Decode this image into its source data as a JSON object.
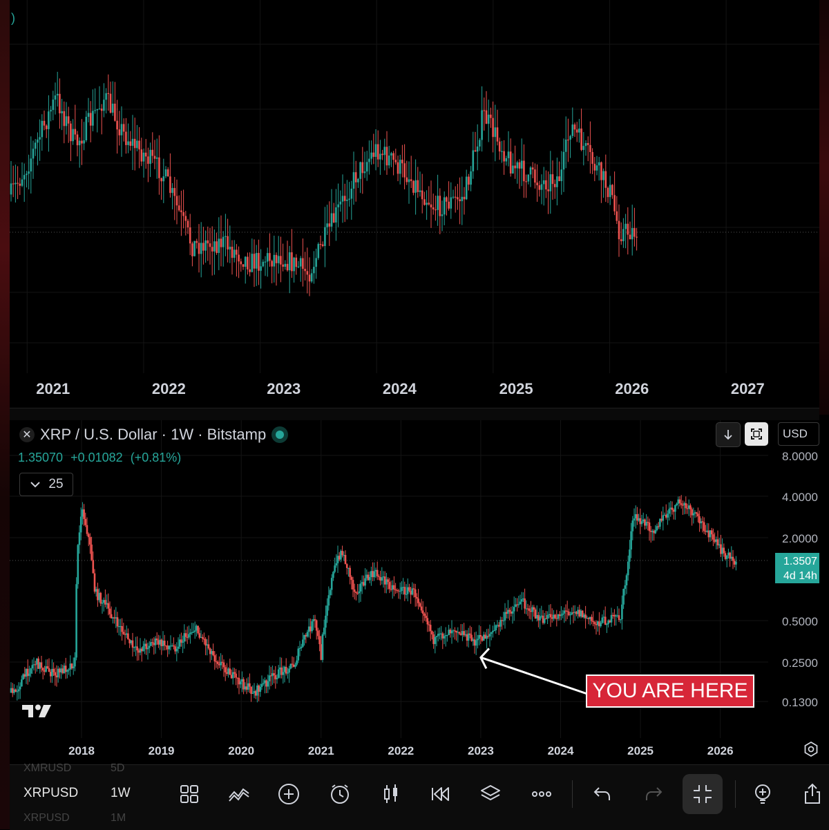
{
  "top_chart": {
    "corner_glyph": ")",
    "x_ticks": [
      "2021",
      "2022",
      "2023",
      "2024",
      "2025",
      "2026",
      "2027"
    ],
    "x_tick_pos": [
      0.045,
      0.188,
      0.33,
      0.473,
      0.617,
      0.76,
      0.903
    ]
  },
  "symbol_bar": {
    "icon": "xrp-icon",
    "title": "XRP / U.S. Dollar · 1W · Bitstamp",
    "status": "market-open-dot",
    "last_price": "1.35070",
    "change": "+0.01082",
    "change_pct": "(+0.81%)",
    "indicator_count": "25",
    "download_icon": "arrow-down-icon",
    "mode_icon": "scale-mode-icon",
    "currency": "USD"
  },
  "price_axis": {
    "labels": [
      "8.0000",
      "4.0000",
      "2.0000",
      "1.3507",
      "0.5000",
      "0.2500",
      "0.1300"
    ],
    "tag_price": "1.3507",
    "tag_time": "4d 14h"
  },
  "bottom_chart": {
    "x_ticks": [
      "2018",
      "2019",
      "2020",
      "2021",
      "2022",
      "2023",
      "2024",
      "2025",
      "2026"
    ]
  },
  "annotation": {
    "label": "YOU ARE HERE"
  },
  "chart_data": {
    "type": "line",
    "title": "XRP / U.S. Dollar · 1W · Bitstamp",
    "series": [
      {
        "x": [
          "2017-03",
          "2017-06",
          "2017-09",
          "2017-12",
          "2018-01",
          "2018-03",
          "2018-06",
          "2018-09",
          "2018-12",
          "2019-03",
          "2019-06",
          "2019-09",
          "2019-12",
          "2020-03",
          "2020-06",
          "2020-09",
          "2020-12",
          "2021-01",
          "2021-04",
          "2021-06",
          "2021-09",
          "2021-12",
          "2022-03",
          "2022-06",
          "2022-09",
          "2022-12",
          "2023-03",
          "2023-07",
          "2023-10",
          "2024-03",
          "2024-06",
          "2024-10",
          "2024-11",
          "2024-12",
          "2025-03",
          "2025-07",
          "2025-10",
          "2026-01",
          "2026-03"
        ],
        "values": [
          0.15,
          0.25,
          0.2,
          0.25,
          3.3,
          0.8,
          0.5,
          0.3,
          0.35,
          0.32,
          0.44,
          0.27,
          0.19,
          0.15,
          0.2,
          0.24,
          0.5,
          0.27,
          1.6,
          0.8,
          1.1,
          0.85,
          0.8,
          0.35,
          0.45,
          0.35,
          0.42,
          0.7,
          0.5,
          0.6,
          0.48,
          0.53,
          1.1,
          2.8,
          2.3,
          3.6,
          2.6,
          1.6,
          1.35
        ]
      }
    ],
    "x_ticks": [
      "2018",
      "2019",
      "2020",
      "2021",
      "2022",
      "2023",
      "2024",
      "2025",
      "2026"
    ],
    "y_scale": "log",
    "y_ticks": [
      "8.0000",
      "4.0000",
      "2.0000",
      "0.5000",
      "0.2500",
      "0.1300"
    ],
    "ylim": [
      0.1,
      8
    ],
    "last_price": 1.3507,
    "top_panel": {
      "x_ticks": [
        "2021",
        "2022",
        "2023",
        "2024",
        "2025",
        "2026",
        "2027"
      ],
      "x": [
        "2020-11",
        "2021-01",
        "2021-04",
        "2021-06",
        "2021-09",
        "2021-11",
        "2022-03",
        "2022-06",
        "2022-09",
        "2022-12",
        "2023-03",
        "2023-06",
        "2023-09",
        "2023-11",
        "2024-01",
        "2024-04",
        "2024-07",
        "2024-10",
        "2024-12",
        "2025-03",
        "2025-06",
        "2025-08",
        "2025-09",
        "2025-11",
        "2026-01",
        "2026-02",
        "2026-03"
      ],
      "values": [
        290,
        240,
        140,
        210,
        140,
        195,
        250,
        355,
        350,
        380,
        370,
        395,
        305,
        250,
        215,
        250,
        300,
        285,
        165,
        240,
        265,
        255,
        180,
        230,
        275,
        335,
        335
      ]
    }
  },
  "toolbar": {
    "watchlist_prev": {
      "symbol": "XMRUSD",
      "interval": "5D"
    },
    "watchlist_current": {
      "symbol": "XRPUSD",
      "interval": "1W"
    },
    "watchlist_next": {
      "symbol": "XRPUSD",
      "interval": "1M"
    },
    "tools": [
      "layout-grid-icon",
      "indicators-icon",
      "add-icon",
      "alert-clock-icon",
      "candle-type-icon",
      "replay-icon",
      "layers-icon",
      "more-icon",
      "undo-icon",
      "redo-icon",
      "fullscreen-exit-icon",
      "ideas-bulb-icon",
      "share-icon"
    ]
  },
  "colors": {
    "up": "#26a69a",
    "down": "#ef5350",
    "callout": "#d72638",
    "background": "#000000"
  }
}
